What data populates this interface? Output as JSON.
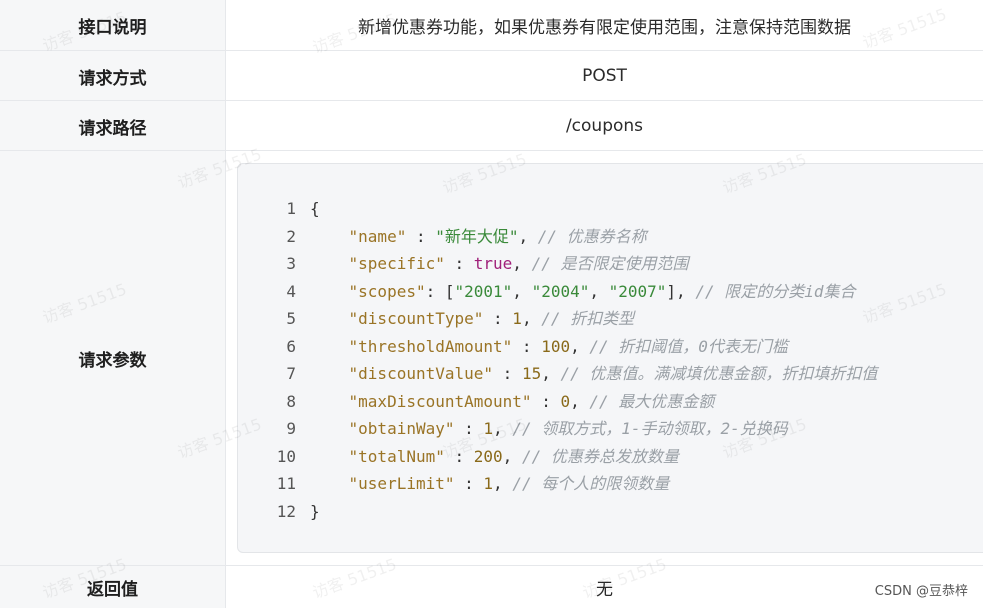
{
  "rows": {
    "desc": {
      "label": "接口说明",
      "value": "新增优惠券功能，如果优惠券有限定使用范围，注意保持范围数据"
    },
    "method": {
      "label": "请求方式",
      "value": "POST"
    },
    "path": {
      "label": "请求路径",
      "value": "/coupons"
    },
    "params": {
      "label": "请求参数"
    },
    "ret": {
      "label": "返回值",
      "value": "无"
    }
  },
  "code": {
    "lines": [
      {
        "n": "1",
        "parts": [
          {
            "t": "{",
            "c": "p"
          }
        ]
      },
      {
        "n": "2",
        "parts": [
          {
            "t": "    ",
            "c": "p"
          },
          {
            "t": "\"name\"",
            "c": "k"
          },
          {
            "t": " : ",
            "c": "p"
          },
          {
            "t": "\"新年大促\"",
            "c": "s"
          },
          {
            "t": ", ",
            "c": "p"
          },
          {
            "t": "// 优惠券名称",
            "c": "c"
          }
        ]
      },
      {
        "n": "3",
        "parts": [
          {
            "t": "    ",
            "c": "p"
          },
          {
            "t": "\"specific\"",
            "c": "k"
          },
          {
            "t": " : ",
            "c": "p"
          },
          {
            "t": "true",
            "c": "b"
          },
          {
            "t": ", ",
            "c": "p"
          },
          {
            "t": "// 是否限定使用范围",
            "c": "c"
          }
        ]
      },
      {
        "n": "4",
        "parts": [
          {
            "t": "    ",
            "c": "p"
          },
          {
            "t": "\"scopes\"",
            "c": "k"
          },
          {
            "t": ": [",
            "c": "p"
          },
          {
            "t": "\"2001\"",
            "c": "s"
          },
          {
            "t": ", ",
            "c": "p"
          },
          {
            "t": "\"2004\"",
            "c": "s"
          },
          {
            "t": ", ",
            "c": "p"
          },
          {
            "t": "\"2007\"",
            "c": "s"
          },
          {
            "t": "], ",
            "c": "p"
          },
          {
            "t": "// 限定的分类id集合",
            "c": "c"
          }
        ]
      },
      {
        "n": "5",
        "parts": [
          {
            "t": "    ",
            "c": "p"
          },
          {
            "t": "\"discountType\"",
            "c": "k"
          },
          {
            "t": " : ",
            "c": "p"
          },
          {
            "t": "1",
            "c": "n"
          },
          {
            "t": ", ",
            "c": "p"
          },
          {
            "t": "// 折扣类型",
            "c": "c"
          }
        ]
      },
      {
        "n": "6",
        "parts": [
          {
            "t": "    ",
            "c": "p"
          },
          {
            "t": "\"thresholdAmount\"",
            "c": "k"
          },
          {
            "t": " : ",
            "c": "p"
          },
          {
            "t": "100",
            "c": "n"
          },
          {
            "t": ", ",
            "c": "p"
          },
          {
            "t": "// 折扣阈值，0代表无门槛",
            "c": "c"
          }
        ]
      },
      {
        "n": "7",
        "parts": [
          {
            "t": "    ",
            "c": "p"
          },
          {
            "t": "\"discountValue\"",
            "c": "k"
          },
          {
            "t": " : ",
            "c": "p"
          },
          {
            "t": "15",
            "c": "n"
          },
          {
            "t": ", ",
            "c": "p"
          },
          {
            "t": "// 优惠值。满减填优惠金额，折扣填折扣值",
            "c": "c"
          }
        ]
      },
      {
        "n": "8",
        "parts": [
          {
            "t": "    ",
            "c": "p"
          },
          {
            "t": "\"maxDiscountAmount\"",
            "c": "k"
          },
          {
            "t": " : ",
            "c": "p"
          },
          {
            "t": "0",
            "c": "n"
          },
          {
            "t": ", ",
            "c": "p"
          },
          {
            "t": "// 最大优惠金额",
            "c": "c"
          }
        ]
      },
      {
        "n": "9",
        "parts": [
          {
            "t": "    ",
            "c": "p"
          },
          {
            "t": "\"obtainWay\"",
            "c": "k"
          },
          {
            "t": " : ",
            "c": "p"
          },
          {
            "t": "1",
            "c": "n"
          },
          {
            "t": ", ",
            "c": "p"
          },
          {
            "t": "// 领取方式，1-手动领取，2-兑换码",
            "c": "c"
          }
        ]
      },
      {
        "n": "10",
        "parts": [
          {
            "t": "    ",
            "c": "p"
          },
          {
            "t": "\"totalNum\"",
            "c": "k"
          },
          {
            "t": " : ",
            "c": "p"
          },
          {
            "t": "200",
            "c": "n"
          },
          {
            "t": ", ",
            "c": "p"
          },
          {
            "t": "// 优惠券总发放数量",
            "c": "c"
          }
        ]
      },
      {
        "n": "11",
        "parts": [
          {
            "t": "    ",
            "c": "p"
          },
          {
            "t": "\"userLimit\"",
            "c": "k"
          },
          {
            "t": " : ",
            "c": "p"
          },
          {
            "t": "1",
            "c": "n"
          },
          {
            "t": ", ",
            "c": "p"
          },
          {
            "t": "// 每个人的限领数量",
            "c": "c"
          }
        ]
      },
      {
        "n": "12",
        "parts": [
          {
            "t": "}",
            "c": "p"
          }
        ]
      }
    ]
  },
  "watermark_text": "访客 51515",
  "credit": "CSDN @豆恭梓"
}
